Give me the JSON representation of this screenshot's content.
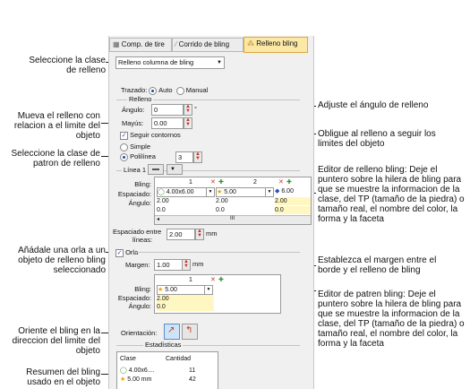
{
  "annotations": {
    "select_fill_class": "Seleccione la clase de relleno",
    "fill_angle": "Adjuste el ángulo de relleno",
    "move_fill": "Mueva el relleno con relacion a el limite del objeto",
    "follow_contours": "Obligue al relleno a seguir los limites del objeto",
    "pattern_class": "Seleccione la clase de patron de relleno",
    "fill_editor": "Editor de relleno bling: Deje el puntero sobre la hilera de bling para que se muestre la informacion de la clase, del TP (tamaño de la piedra) o tamaño real, el nombre del color, la forma y la faceta",
    "add_border": "Añádale una orla a un objeto de relleno bling seleccionado",
    "margin": "Establezca el margen entre el borde y el relleno de bling",
    "pattern_editor": "Editor de patren bling: Deje el puntero sobre la hilera de bling para que se muestre la informacion de la clase, del TP (tamaño de la piedra) o tamaño real, el nombre del color, la forma y la faceta",
    "orient": "Oriente el bling en la direccion del limite del objeto",
    "summary": "Resumen del bling usado en el objeto"
  },
  "tabs": [
    "Comp. de tire",
    "Corrido de bling",
    "Relleno bling"
  ],
  "fill_class": "Relleno columna de bling",
  "trazado": {
    "label": "Trazado:",
    "auto": "Auto",
    "manual": "Manual",
    "selected": "Auto"
  },
  "relleno_group": "Relleno",
  "angulo": {
    "label": "Ángulo:",
    "value": "0",
    "unit": "°"
  },
  "mayus": {
    "label": "Mayús:",
    "value": "0.00"
  },
  "seguir": {
    "label": "Seguir contornos",
    "checked": true
  },
  "simple": "Simple",
  "polilinea": {
    "label": "Polilínea",
    "value": "3"
  },
  "linea1": "Línea 1",
  "grid1": {
    "columns": [
      "1",
      "2"
    ],
    "rows": [
      {
        "label": "Bling:",
        "cells": [
          "4.00x6.00",
          "5.00",
          "6.00"
        ]
      },
      {
        "label": "Espaciado:",
        "cells": [
          "2.00",
          "2.00",
          "2.00"
        ]
      },
      {
        "label": "Ángulo:",
        "cells": [
          "0.0",
          "0.0",
          "0.0"
        ]
      }
    ],
    "scroll": "III"
  },
  "espaciado_entre": {
    "label1": "Espaciado entre",
    "label2": "líneas:",
    "value": "2.00",
    "unit": "mm"
  },
  "orla": {
    "label": "Orla",
    "checked": true
  },
  "margen": {
    "label": "Margen:",
    "value": "1.00",
    "unit": "mm"
  },
  "grid2": {
    "column": "1",
    "rows": [
      {
        "label": "Bling:",
        "cell": "5.00"
      },
      {
        "label": "Espaciado:",
        "cell": "2.00"
      },
      {
        "label": "Ángulo:",
        "cell": "0.0"
      }
    ]
  },
  "orientacion": "Orientación:",
  "estadisticas": "Estadísticas",
  "stats": {
    "headers": [
      "Clase",
      "Cantidad"
    ],
    "rows": [
      {
        "clase": "4.00x6....",
        "cantidad": "11"
      },
      {
        "clase": "5.00 mm",
        "cantidad": "42"
      }
    ]
  },
  "colors": {
    "accent_tab": "#fbe8a6",
    "highlight": "#fff7c2",
    "star": "#f0a000",
    "drop": "#1f4fc8",
    "ring": "#2f8f2f"
  }
}
